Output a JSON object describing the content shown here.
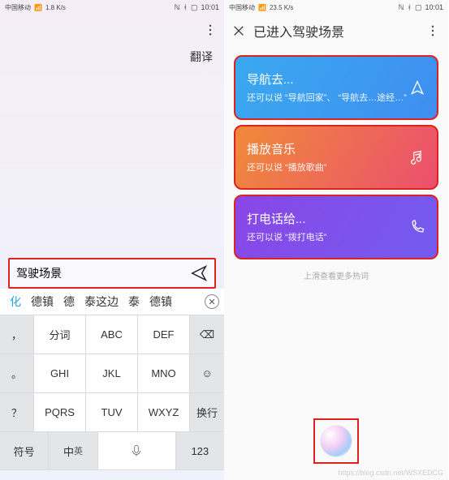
{
  "status": {
    "carrier": "中国移动",
    "net": "1.8 K/s",
    "net2": "23.5 K/s",
    "time": "10:01"
  },
  "left": {
    "translate": "翻译",
    "input_value": "驾驶场景",
    "candidates": [
      "化",
      "德镇",
      "德",
      "泰这边",
      "泰",
      "德镇"
    ],
    "keys": {
      "r1": [
        "，",
        "分词",
        "ABC",
        "DEF"
      ],
      "r2": [
        "。",
        "GHI",
        "JKL",
        "MNO"
      ],
      "r3": [
        "？",
        "PQRS",
        "TUV",
        "WXYZ"
      ],
      "backspace": "⌫",
      "smile": "☺",
      "enter": "换行",
      "r4": [
        "符号",
        "中",
        "␣",
        "123"
      ],
      "mic": "🎤"
    }
  },
  "right": {
    "title": "已进入驾驶场景",
    "cards": [
      {
        "title": "导航去...",
        "sub": "还可以说 “导航回家”、 “导航去…途经…”"
      },
      {
        "title": "播放音乐",
        "sub": "还可以说 “播放歌曲”"
      },
      {
        "title": "打电话给...",
        "sub": "还可以说 “拨打电话”"
      }
    ],
    "footer": "上滑查看更多热词"
  },
  "watermark": "https://blog.csdn.net/WSXEDCG"
}
